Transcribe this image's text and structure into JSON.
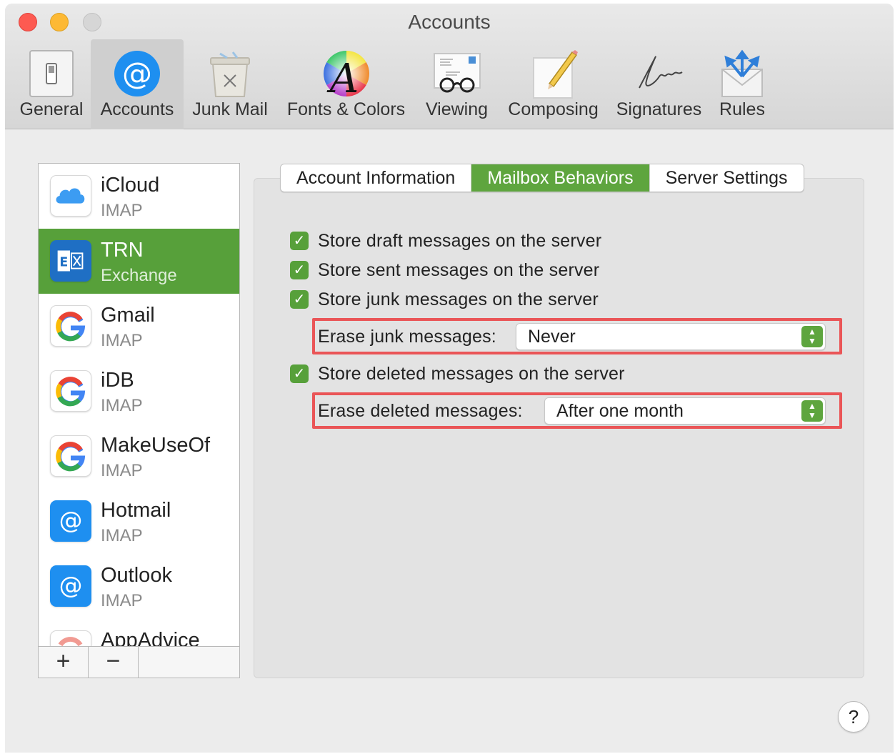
{
  "window": {
    "title": "Accounts"
  },
  "toolbar": {
    "items": [
      {
        "label": "General",
        "icon": "general-switch-icon"
      },
      {
        "label": "Accounts",
        "icon": "at-sign-icon"
      },
      {
        "label": "Junk Mail",
        "icon": "trash-can-icon"
      },
      {
        "label": "Fonts & Colors",
        "icon": "color-wheel-font-icon"
      },
      {
        "label": "Viewing",
        "icon": "glasses-envelope-icon"
      },
      {
        "label": "Composing",
        "icon": "pencil-paper-icon"
      },
      {
        "label": "Signatures",
        "icon": "signature-icon"
      },
      {
        "label": "Rules",
        "icon": "envelope-arrows-icon"
      }
    ],
    "selected": "Accounts"
  },
  "sidebar": {
    "accounts": [
      {
        "name": "iCloud",
        "type": "IMAP",
        "icon": "icloud-icon"
      },
      {
        "name": "TRN",
        "type": "Exchange",
        "icon": "exchange-icon"
      },
      {
        "name": "Gmail",
        "type": "IMAP",
        "icon": "google-icon"
      },
      {
        "name": "iDB",
        "type": "IMAP",
        "icon": "google-icon"
      },
      {
        "name": "MakeUseOf",
        "type": "IMAP",
        "icon": "google-icon"
      },
      {
        "name": "Hotmail",
        "type": "IMAP",
        "icon": "at-sign-icon"
      },
      {
        "name": "Outlook",
        "type": "IMAP",
        "icon": "at-sign-icon"
      },
      {
        "name": "AppAdvice",
        "type": "",
        "icon": "google-icon"
      }
    ],
    "selected": "TRN",
    "add_label": "+",
    "remove_label": "−"
  },
  "tabs": [
    {
      "label": "Account Information"
    },
    {
      "label": "Mailbox Behaviors"
    },
    {
      "label": "Server Settings"
    }
  ],
  "selected_tab": "Mailbox Behaviors",
  "options": {
    "draft": {
      "label": "Store draft messages on the server",
      "checked": true
    },
    "sent": {
      "label": "Store sent messages on the server",
      "checked": true
    },
    "junk": {
      "label": "Store junk messages on the server",
      "checked": true
    },
    "erase_junk": {
      "label": "Erase junk messages:",
      "value": "Never"
    },
    "deleted": {
      "label": "Store deleted messages on the server",
      "checked": true
    },
    "erase_deleted": {
      "label": "Erase deleted messages:",
      "value": "After one month"
    }
  },
  "help_label": "?",
  "colors": {
    "accent": "#57a03a",
    "highlight": "#ea5557"
  }
}
